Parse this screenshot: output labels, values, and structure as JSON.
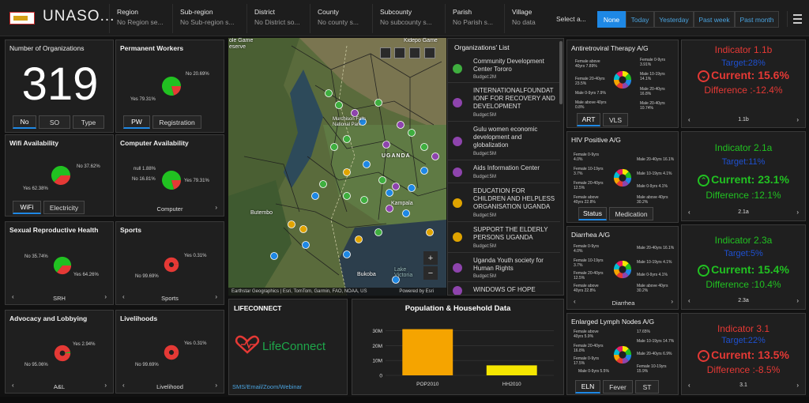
{
  "header": {
    "title": "UNASO...",
    "filters": [
      {
        "label": "Region",
        "value": "No Region se..."
      },
      {
        "label": "Sub-region",
        "value": "No Sub-region s..."
      },
      {
        "label": "District",
        "value": "No District so..."
      },
      {
        "label": "County",
        "value": "No county s..."
      },
      {
        "label": "Subcounty",
        "value": "No subcounty s..."
      },
      {
        "label": "Parish",
        "value": "No Parish s..."
      },
      {
        "label": "Village",
        "value": "No data"
      }
    ],
    "select_label": "Select a...",
    "time_buttons": [
      "None",
      "Today",
      "Yesterday",
      "Past week",
      "Past month"
    ],
    "active_time": "None"
  },
  "org_count": {
    "title": "Number of Organizations",
    "value": "319",
    "tabs": [
      "No",
      "SO",
      "Type"
    ],
    "active_tab": "No"
  },
  "permanent_workers": {
    "title": "Permanent Workers",
    "no_label": "No 20.69%",
    "yes_label": "Yes 79.31%",
    "yes_pct": 79.31,
    "tabs": [
      "PW",
      "Registration"
    ],
    "active_tab": "PW"
  },
  "wifi": {
    "title": "Wifi Availability",
    "no_label": "No 37.62%",
    "yes_label": "Yes 62.38%",
    "yes_pct": 62.38,
    "tabs": [
      "WiFi",
      "Electricity"
    ],
    "active_tab": "WiFi"
  },
  "computer": {
    "title": "Computer Availability",
    "null_label": "null 1.88%",
    "no_label": "No 16.81%",
    "yes_label": "Yes 79.31%",
    "yes_pct": 79.31,
    "pager": "Computer"
  },
  "srh": {
    "title": "Sexual Reproductive Health",
    "no_label": "No 35.74%",
    "yes_label": "Yes 64.26%",
    "yes_pct": 64.26,
    "pager": "SRH"
  },
  "sports": {
    "title": "Sports",
    "yes_label": "Yes 0.31%",
    "no_label": "No 99.69%",
    "yes_pct": 0.31,
    "pager": "Sports"
  },
  "advocacy": {
    "title": "Advocacy and Lobbying",
    "yes_label": "Yes 2.94%",
    "no_label": "No 95.06%",
    "yes_pct": 2.94,
    "pager": "A&L"
  },
  "livelihoods": {
    "title": "Livelihoods",
    "yes_label": "Yes 0.31%",
    "no_label": "No 99.69%",
    "yes_pct": 0.31,
    "pager": "Livelihood"
  },
  "map": {
    "labels": {
      "uganda": "UGANDA",
      "kampala": "Kampala",
      "butembo": "Butembo",
      "bukoba": "Bukoba",
      "lake_victoria": "Lake Victoria",
      "murchison": "Murchison Falls National Park",
      "kidepo": "Kidepo Game",
      "game": "ole Game",
      "reserve": "eserve"
    },
    "attribution": "Earthstar Geographics | Esri, TomTom, Garmin, FAO, NOAA, US",
    "powered": "Powered by Esri",
    "zoom_in": "+",
    "zoom_out": "−"
  },
  "org_list": {
    "title": "Organizations' List",
    "items": [
      {
        "name": "Community Development Center Tororo",
        "budget": "Budget:2M",
        "color": "#3fae3f"
      },
      {
        "name": "INTERNATIONALFOUNDAT IONF FOR RECOVERY AND DEVELOPMENT",
        "budget": "Budget:5M",
        "color": "#8e44ad"
      },
      {
        "name": "Gulu women economic development and globalization",
        "budget": "Budget:5M",
        "color": "#8e44ad"
      },
      {
        "name": "Aids Information Center",
        "budget": "Budget:5M",
        "color": "#8e44ad"
      },
      {
        "name": "EDUCATION FOR CHILDREN AND HELPLESS ORGANISATION UGANDA",
        "budget": "Budget:5M",
        "color": "#e0a400"
      },
      {
        "name": "SUPPORT THE ELDERLY PERSONS UGANDA",
        "budget": "Budget:5M",
        "color": "#e0a400"
      },
      {
        "name": "Uganda Youth society for Human Rights",
        "budget": "Budget:5M",
        "color": "#8e44ad"
      },
      {
        "name": "WINDOWS OF HOPE CHILDREN HOPE",
        "budget": "",
        "color": "#8e44ad"
      }
    ]
  },
  "lifeconnect": {
    "title": "LIFECONNECT",
    "brand": "LifeConnect",
    "footer": "SMS/Email/Zoom/Webinar"
  },
  "population": {
    "title": "Population & Household Data"
  },
  "chart_data": {
    "type": "bar",
    "title": "Population & Household Data",
    "categories": [
      "POP2010",
      "HH2010"
    ],
    "values": [
      31000000,
      6700000
    ],
    "colors": [
      "#f5a400",
      "#f5e600"
    ],
    "ylim": [
      0,
      35000000
    ],
    "yticks": [
      "0",
      "10M",
      "20M",
      "30M"
    ],
    "ytick_values": [
      0,
      10000000,
      20000000,
      30000000
    ],
    "xlabel": "",
    "ylabel": ""
  },
  "art": {
    "title": "Antiretroviral Therapy A/G",
    "labels_left": [
      "Female above 40yrs 7.89%",
      "Female 20-40yrs 23.5%",
      "Male 0-9yrs 7.9%",
      "Male above 40yrs 0.8%"
    ],
    "labels_right": [
      "Female 0-9yrs 3.91%",
      "Male 10-19yrs 14.1%",
      "Male 20-40yrs 16.8%",
      "Male 20-40yrs 10.74%"
    ],
    "tabs": [
      "ART",
      "VLS"
    ],
    "active_tab": "ART"
  },
  "hiv": {
    "title": "HIV Positive A/G",
    "labels_left": [
      "Female 0-9yrs 4.0%",
      "Female 10-19yrs 3.7%",
      "Female 20-40yrs 12.5%",
      "Female above 40yrs 22.8%"
    ],
    "labels_right": [
      "Male 20-40yrs 16.1%",
      "Male 10-19yrs 4.1%",
      "Male 0-9yrs 4.1%",
      "Male above 40yrs 30.2%"
    ],
    "tabs": [
      "Status",
      "Medication"
    ],
    "active_tab": "Status"
  },
  "diarrhea": {
    "title": "Diarrhea A/G",
    "labels_left": [
      "Female 0-9yrs 4.0%",
      "Female 10-19yrs 3.7%",
      "Female 20-40yrs 12.5%",
      "Female above 40yrs 22.8%"
    ],
    "labels_right": [
      "Male 20-40yrs 16.1%",
      "Male 10-19yrs 4.1%",
      "Male 0-9yrs 4.1%",
      "Male above 40yrs 30.2%"
    ],
    "pager": "Diarrhea"
  },
  "eln": {
    "title": "Enlarged Lymph Nodes A/G",
    "labels_left": [
      "Female above 40yrs 5.9%",
      "Female 20-40yrs 16.8%",
      "Female 0-9yrs 17.5%",
      "Male 0-9yrs 5.5%"
    ],
    "labels_right": [
      "17.65%",
      "Male 10-19yrs 14.7%",
      "Male 20-40yrs 6.9%",
      "Female 10-19yrs 15.9%"
    ],
    "tabs": [
      "ELN",
      "Fever",
      "ST"
    ],
    "active_tab": "ELN"
  },
  "kpis": [
    {
      "title": "Indicator 1.1b",
      "target": "Target:28%",
      "current": "Current: 15.6%",
      "difference": "Difference :-12.4%",
      "nav": "1.1b",
      "status": "down",
      "color": "#e53935"
    },
    {
      "title": "Indicator 2.1a",
      "target": "Target:11%",
      "current": "Current: 23.1%",
      "difference": "Difference :12.1%",
      "nav": "2.1a",
      "status": "up",
      "color": "#21c121"
    },
    {
      "title": "Indicator 2.3a",
      "target": "Target:5%",
      "current": "Current: 15.4%",
      "difference": "Difference :10.4%",
      "nav": "2.3a",
      "status": "up",
      "color": "#21c121"
    },
    {
      "title": "Indicator 3.1",
      "target": "Target:22%",
      "current": "Current: 13.5%",
      "difference": "Difference :-8.5%",
      "nav": "3.1",
      "status": "down",
      "color": "#e53935"
    }
  ]
}
